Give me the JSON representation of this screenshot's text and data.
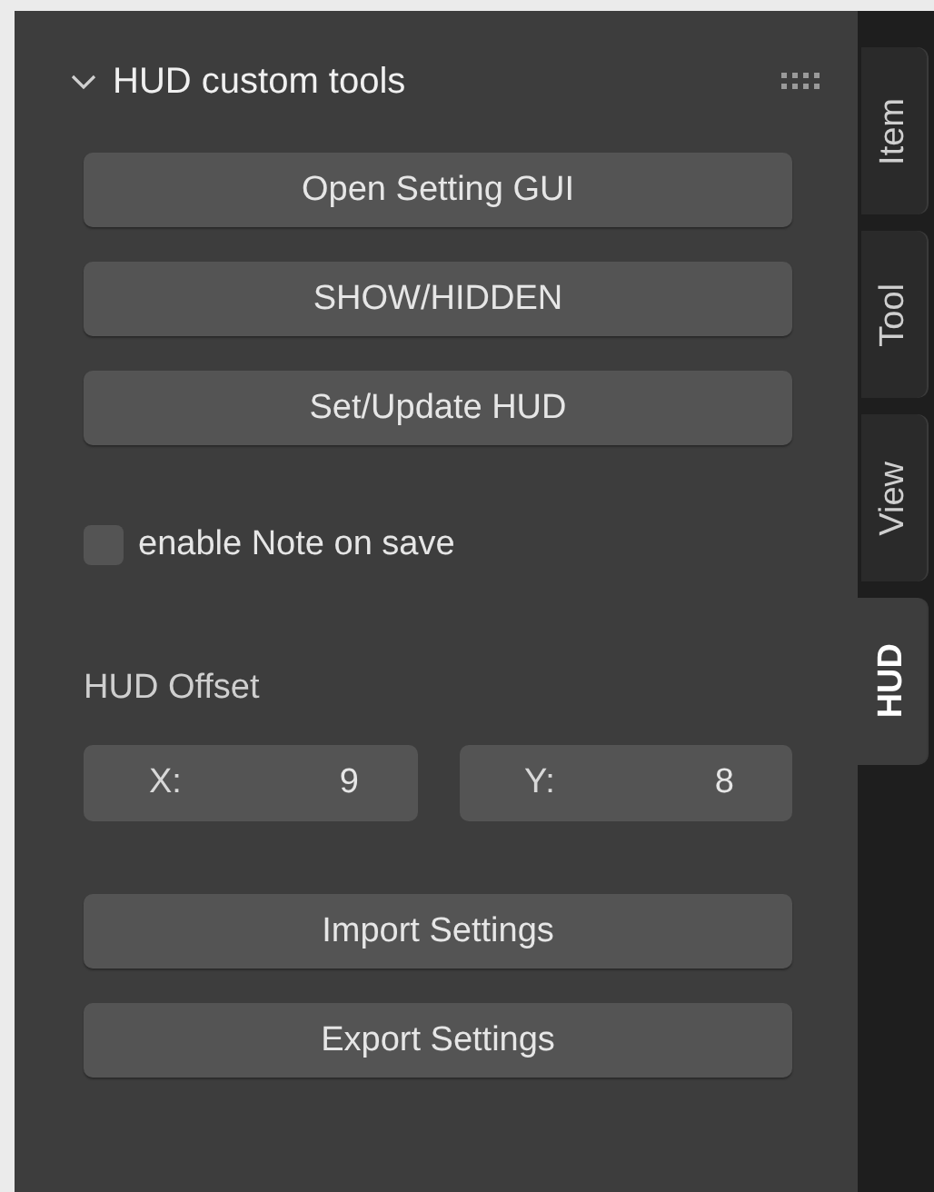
{
  "panel": {
    "title": "HUD custom tools",
    "expanded": true
  },
  "buttons": [
    {
      "label": "Open Setting GUI"
    },
    {
      "label": "SHOW/HIDDEN"
    },
    {
      "label": "Set/Update HUD"
    }
  ],
  "checkbox": {
    "label": "enable Note on save",
    "checked": false
  },
  "offset": {
    "label": "HUD Offset",
    "fields": [
      {
        "label": "X:",
        "value": "9"
      },
      {
        "label": "Y:",
        "value": "8"
      }
    ]
  },
  "buttons_bottom": [
    {
      "label": "Import Settings"
    },
    {
      "label": "Export Settings"
    }
  ],
  "tabs": [
    {
      "label": "Item",
      "selected": false
    },
    {
      "label": "Tool",
      "selected": false
    },
    {
      "label": "View",
      "selected": false
    },
    {
      "label": "HUD",
      "selected": true
    }
  ]
}
